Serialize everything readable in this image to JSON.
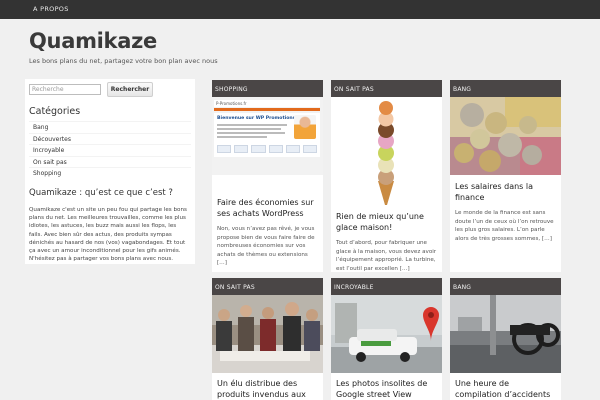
{
  "nav": {
    "about": "A PROPOS"
  },
  "site": {
    "title": "Quamikaze",
    "tagline": "Les bons plans du net, partagez votre bon plan avec nous"
  },
  "sidebar": {
    "search_placeholder": "Recherche",
    "search_button": "Rechercher",
    "categories_title": "Catégories",
    "categories": [
      "Bang",
      "Découvertes",
      "Incroyable",
      "On sait pas",
      "Shopping"
    ],
    "about_title": "Quamikaze : qu’est ce que c’est ?",
    "about_text": "Quamikaze c'est un site un peu fou qui partage les bons plans du net. Les meilleures trouvailles, comme les plus idiotes, les astuces, les buzz mais aussi les flops, les fails. Avec bien sûr des actus, des produits sympas dénichés au hasard de nos (vos) vagabondages. Et tout ça avec un amour inconditionnel pour les gifs animés. N'hésitez pas à partager vos bons plans avec nous."
  },
  "posts": [
    {
      "category": "SHOPPING",
      "title": "Faire des économies sur ses achats WordPress",
      "excerpt": "Non, vous n’avez pas rêvé, je vous propose bien de vous faire faire de nombreuses économies sur vos achats de thèmes ou extensions […]",
      "thumb_header": "P-Promotions.fr",
      "thumb_heading": "Bienvenue sur WP Promotions!"
    },
    {
      "category": "ON SAIT PAS",
      "title": "Rien de mieux qu’une glace maison!",
      "excerpt": "Tout d’abord, pour fabriquer une glace à la maison, vous devez avoir l’équipement approprié.  La turbine, est l’outil par excellen […]"
    },
    {
      "category": "BANG",
      "title": "Les salaires dans la finance",
      "excerpt": "Le monde de la finance est sans doute l’un de ceux où l’on retrouve les plus gros salaires. L’on parle alors de très grosses sommes, […]"
    },
    {
      "category": "ON SAIT PAS",
      "title": "Un élu distribue des produits invendus aux pauvres"
    },
    {
      "category": "INCROYABLE",
      "title": "Les photos insolites de Google street View"
    },
    {
      "category": "BANG",
      "title": "Une heure de compilation d’accidents de moto"
    }
  ]
}
